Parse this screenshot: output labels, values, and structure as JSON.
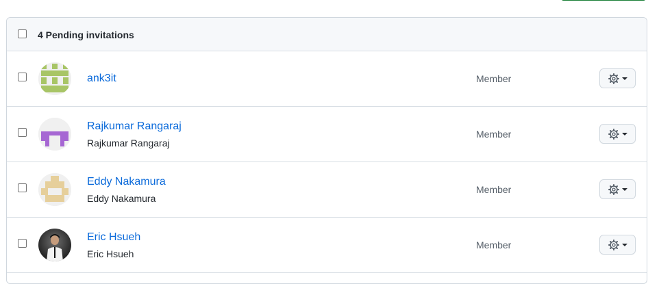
{
  "header": {
    "title": "4 Pending invitations"
  },
  "invitations": [
    {
      "username": "ank3it",
      "full_name": "",
      "role": "Member",
      "avatar_color": "#a8c566"
    },
    {
      "username": "Rajkumar Rangaraj",
      "full_name": "Rajkumar Rangaraj",
      "role": "Member",
      "avatar_color": "#a667d3"
    },
    {
      "username": "Eddy Nakamura",
      "full_name": "Eddy Nakamura",
      "role": "Member",
      "avatar_color": "#e6cf9b"
    },
    {
      "username": "Eric Hsueh",
      "full_name": "Eric Hsueh",
      "role": "Member",
      "avatar_color": "#2d2d2d"
    }
  ],
  "icons": {
    "settings": "gear-icon",
    "menu": "caret-down-icon"
  },
  "colors": {
    "link": "#0969da",
    "header_bg": "#f6f8fa",
    "border": "#d0d7de"
  }
}
